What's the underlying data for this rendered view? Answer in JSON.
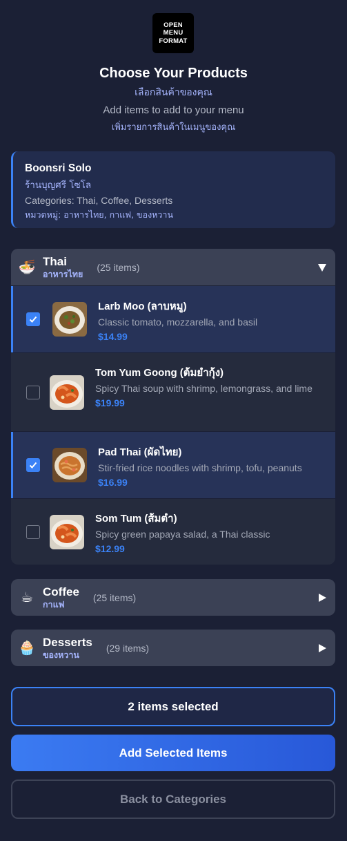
{
  "logo": {
    "line1": "OPEN",
    "line2": "MENU",
    "line3": "FORMAT"
  },
  "header": {
    "title": "Choose Your Products",
    "title_th": "เลือกสินค้าของคุณ",
    "subtitle": "Add items to add to your menu",
    "subtitle_th": "เพิ่มรายการสินค้าในเมนูของคุณ"
  },
  "store": {
    "name": "Boonsri Solo",
    "name_th": "ร้านบุญศรี โซโล",
    "categories": "Categories: Thai, Coffee, Desserts",
    "categories_th": "หมวดหมู่: อาหารไทย, กาแฟ, ของหวาน"
  },
  "categories": [
    {
      "emoji": "🍜",
      "name": "Thai",
      "name_th": "อาหารไทย",
      "count": "(25 items)",
      "expanded": true,
      "items": [
        {
          "name": "Larb Moo (ลาบหมู)",
          "description": "Classic tomato, mozzarella, and basil",
          "price": "$14.99",
          "selected": true
        },
        {
          "name": "Tom Yum Goong (ต้มยำกุ้ง)",
          "description": "Spicy Thai soup with shrimp, lemongrass, and lime",
          "price": "$19.99",
          "selected": false
        },
        {
          "name": "Pad Thai (ผัดไทย)",
          "description": "Stir-fried rice noodles with shrimp, tofu, peanuts",
          "price": "$16.99",
          "selected": true
        },
        {
          "name": "Som Tum (ส้มตำ)",
          "description": "Spicy green papaya salad, a Thai classic",
          "price": "$12.99",
          "selected": false
        }
      ]
    },
    {
      "emoji": "☕",
      "name": "Coffee",
      "name_th": "กาแฟ",
      "count": "(25 items)",
      "expanded": false
    },
    {
      "emoji": "🧁",
      "name": "Desserts",
      "name_th": "ของหวาน",
      "count": "(29 items)",
      "expanded": false
    }
  ],
  "footer": {
    "selected_count": "2 items selected",
    "add_label": "Add Selected Items",
    "back_label": "Back to Categories"
  },
  "colors": {
    "accent": "#3b82f6",
    "background": "#1b2035",
    "thai_text": "#a5b4fc"
  }
}
